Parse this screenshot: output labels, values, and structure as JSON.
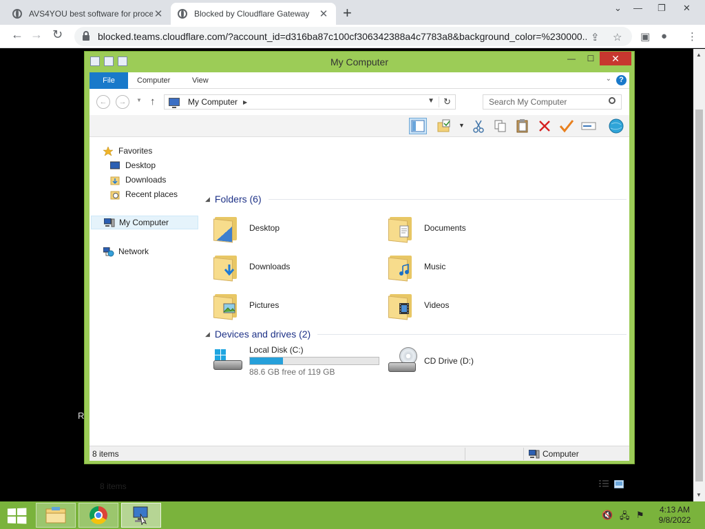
{
  "browser": {
    "tabs": [
      {
        "title": "AVS4YOU best software for proce"
      },
      {
        "title": "Blocked by Cloudflare Gateway"
      }
    ],
    "url": "blocked.teams.cloudflare.com/?account_id=d316ba87c100cf306342388a4c7783a8&background_color=%230000..."
  },
  "page": {
    "stray_text": "R"
  },
  "explorer": {
    "title": "My Computer",
    "ribbon_tabs": [
      "File",
      "Computer",
      "View"
    ],
    "address": {
      "crumb": "My Computer"
    },
    "search_placeholder": "Search My Computer",
    "nav": {
      "favorites": "Favorites",
      "desktop": "Desktop",
      "downloads": "Downloads",
      "recent": "Recent places",
      "computer": "My Computer",
      "network": "Network"
    },
    "folders_header": "Folders (6)",
    "folders": [
      {
        "name": "Desktop"
      },
      {
        "name": "Documents"
      },
      {
        "name": "Downloads"
      },
      {
        "name": "Music"
      },
      {
        "name": "Pictures"
      },
      {
        "name": "Videos"
      }
    ],
    "devices_header": "Devices and drives (2)",
    "drives": {
      "local": {
        "name": "Local Disk (C:)",
        "free_text": "88.6 GB free of 119 GB",
        "used_fraction": 0.255
      },
      "cd": {
        "name": "CD Drive (D:)"
      }
    },
    "item_count": "8 items",
    "status": {
      "left": "8 items",
      "right": "Computer"
    }
  },
  "taskbar": {
    "time": "4:13 AM",
    "date": "9/8/2022"
  },
  "colors": {
    "window_frame": "#9ccc57",
    "taskbar": "#7ab33c",
    "accent": "#1979ca",
    "drive_bar": "#26a0da",
    "close_button": "#c7372f"
  }
}
